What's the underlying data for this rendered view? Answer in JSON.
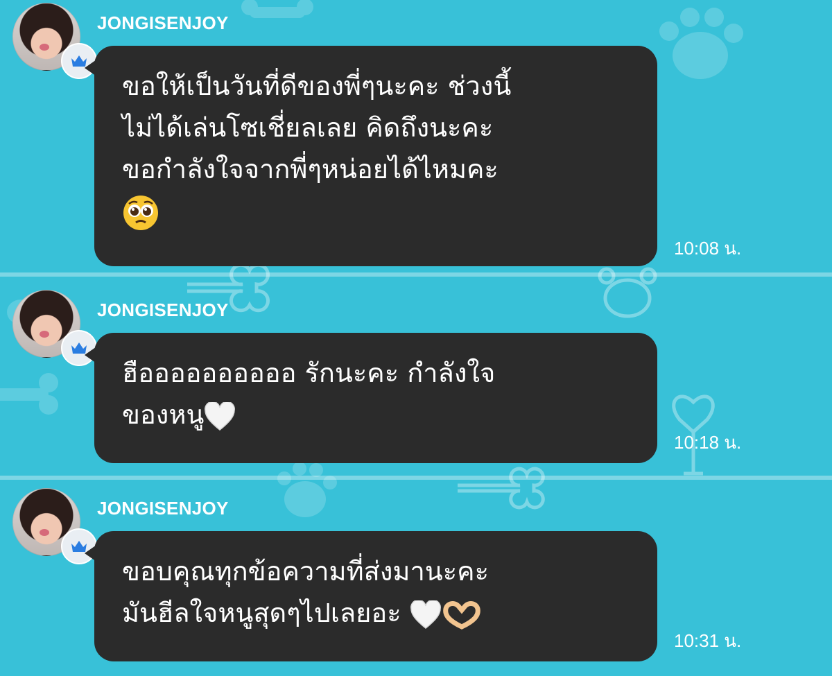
{
  "colors": {
    "background": "#38c1d8",
    "bubble": "#2b2b2b",
    "text": "#ffffff",
    "crown": "#2a7de1"
  },
  "messages": [
    {
      "sender": "JONGISENJOY",
      "lines": [
        "ขอให้เป็นวันที่ดีของพี่ๆนะคะ ช่วงนี้",
        "ไม่ได้เล่นโซเชี่ยลเลย คิดถึงนะคะ",
        "ขอกำลังใจจากพี่ๆหน่อยได้ไหมคะ"
      ],
      "emoji": "pleading-face",
      "time": "10:08 น."
    },
    {
      "sender": "JONGISENJOY",
      "lines": [
        "ฮืออออออออออ รักนะคะ กำลังใจ",
        "ของหนู"
      ],
      "emoji": "white-heart",
      "time": "10:18 น."
    },
    {
      "sender": "JONGISENJOY",
      "lines": [
        "ขอบคุณทุกข้อความที่ส่งมานะคะ",
        "มันฮีลใจหนูสุดๆไปเลยอะ"
      ],
      "emoji": "white-heart, heart-hands",
      "time": "10:31 น."
    }
  ]
}
